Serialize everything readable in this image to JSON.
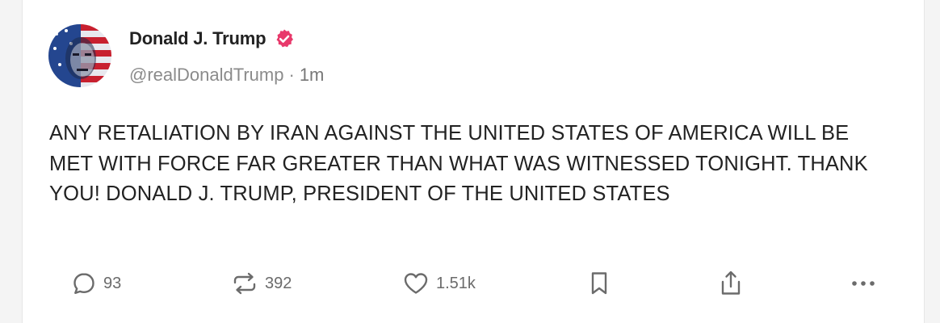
{
  "author": {
    "display_name": "Donald J. Trump",
    "handle": "@realDonaldTrump",
    "separator": "·",
    "time_ago": "1m",
    "verified": true,
    "verified_color": "#e8396b"
  },
  "post": {
    "text": "ANY RETALIATION BY IRAN AGAINST THE UNITED STATES OF AMERICA WILL BE MET WITH FORCE FAR GREATER THAN WHAT WAS WITNESSED TONIGHT. THANK YOU! DONALD J. TRUMP, PRESIDENT OF THE UNITED STATES"
  },
  "actions": {
    "reply_count": "93",
    "repost_count": "392",
    "like_count": "1.51k",
    "icons": [
      "reply-icon",
      "repost-icon",
      "heart-icon",
      "bookmark-icon",
      "share-icon",
      "more-icon"
    ]
  }
}
